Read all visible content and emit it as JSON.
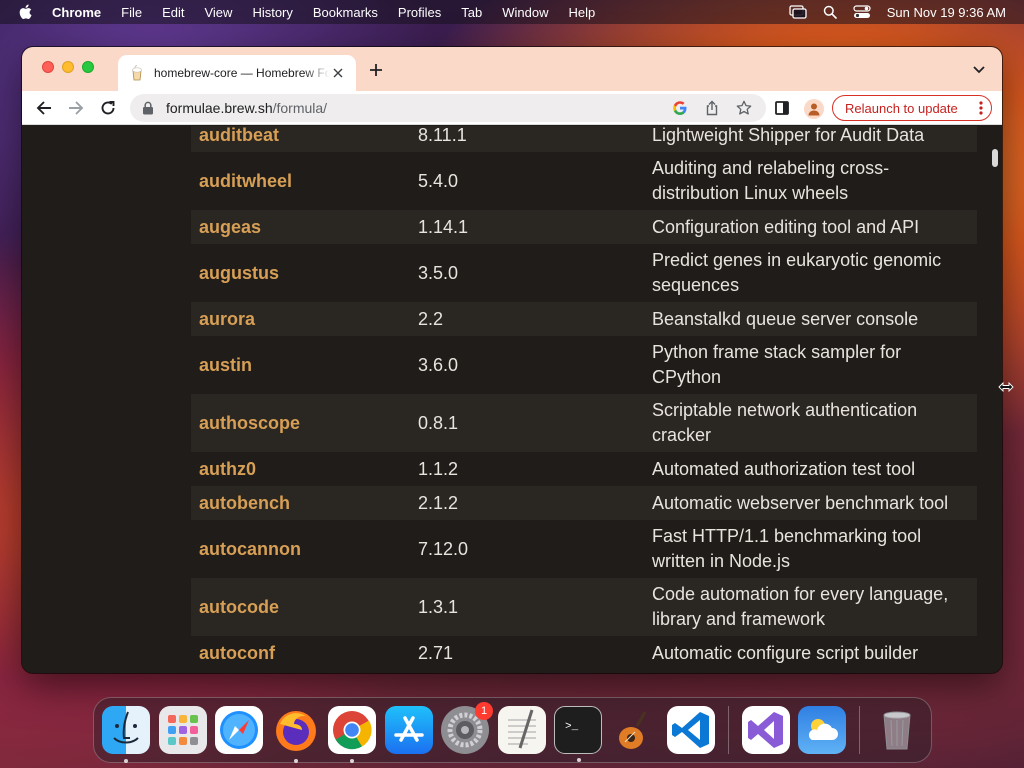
{
  "menubar": {
    "app_name": "Chrome",
    "menus": [
      "File",
      "Edit",
      "View",
      "History",
      "Bookmarks",
      "Profiles",
      "Tab",
      "Window",
      "Help"
    ],
    "clock": "Sun Nov 19  9:36 AM",
    "status_icons": [
      "screen-mirroring-icon",
      "spotlight-search-icon",
      "control-center-icon"
    ]
  },
  "browser": {
    "tab_title": "homebrew-core — Homebrew Formulae",
    "url_host": "formulae.brew.sh",
    "url_path": "/formula/",
    "relaunch_label": "Relaunch to update",
    "colors": {
      "tabstrip": "#fbd9c8",
      "relaunch": "#d93025"
    }
  },
  "formulae": [
    {
      "name": "auditbeat",
      "version": "8.11.1",
      "description": "Lightweight Shipper for Audit Data"
    },
    {
      "name": "auditwheel",
      "version": "5.4.0",
      "description": "Auditing and relabeling cross-distribution Linux wheels"
    },
    {
      "name": "augeas",
      "version": "1.14.1",
      "description": "Configuration editing tool and API"
    },
    {
      "name": "augustus",
      "version": "3.5.0",
      "description": "Predict genes in eukaryotic genomic sequences"
    },
    {
      "name": "aurora",
      "version": "2.2",
      "description": "Beanstalkd queue server console"
    },
    {
      "name": "austin",
      "version": "3.6.0",
      "description": "Python frame stack sampler for CPython"
    },
    {
      "name": "authoscope",
      "version": "0.8.1",
      "description": "Scriptable network authentication cracker"
    },
    {
      "name": "authz0",
      "version": "1.1.2",
      "description": "Automated authorization test tool"
    },
    {
      "name": "autobench",
      "version": "2.1.2",
      "description": "Automatic webserver benchmark tool"
    },
    {
      "name": "autocannon",
      "version": "7.12.0",
      "description": "Fast HTTP/1.1 benchmarking tool written in Node.js"
    },
    {
      "name": "autocode",
      "version": "1.3.1",
      "description": "Code automation for every language, library and framework"
    },
    {
      "name": "autoconf",
      "version": "2.71",
      "description": "Automatic configure script builder"
    }
  ],
  "page_colors": {
    "background": "#1f1c19",
    "row_alt": "#2a2622",
    "formula_name": "#d69f55",
    "text": "#e8e3dc"
  },
  "dock": {
    "apps": [
      "finder-icon",
      "launchpad-icon",
      "safari-icon",
      "firefox-icon",
      "chrome-icon",
      "app-store-icon",
      "system-settings-icon",
      "textedit-icon",
      "terminal-icon",
      "garageband-icon",
      "vscode-icon",
      "visual-studio-icon",
      "weather-icon",
      "trash-icon"
    ],
    "settings_badge": "1"
  }
}
